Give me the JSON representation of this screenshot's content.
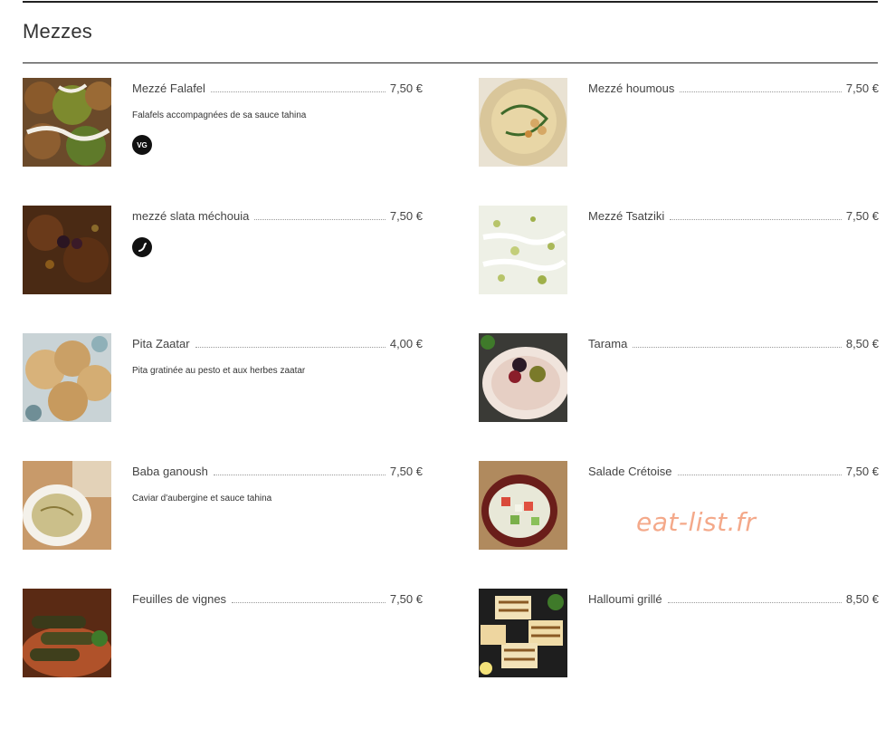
{
  "section": {
    "title": "Mezzes"
  },
  "items": [
    {
      "name": "Mezzé Falafel",
      "price": "7,50 €",
      "description": "Falafels accompagnées de sa sauce tahina",
      "badge": "VG"
    },
    {
      "name": "Mezzé houmous",
      "price": "7,50 €"
    },
    {
      "name": "mezzé slata méchouia",
      "price": "7,50 €",
      "badge_icon": "chili-pepper-icon"
    },
    {
      "name": "Mezzé Tsatziki",
      "price": "7,50 €"
    },
    {
      "name": "Pita Zaatar",
      "price": "4,00 €",
      "description": "Pita gratinée au pesto et aux herbes zaatar"
    },
    {
      "name": "Tarama",
      "price": "8,50 €"
    },
    {
      "name": "Baba ganoush",
      "price": "7,50 €",
      "description": "Caviar d'aubergine et sauce tahina"
    },
    {
      "name": "Salade Crétoise",
      "price": "7,50 €"
    },
    {
      "name": "Feuilles de vignes",
      "price": "7,50 €"
    },
    {
      "name": "Halloumi grillé",
      "price": "8,50 €"
    }
  ],
  "watermark": "eat-list.fr",
  "colors": {
    "rule": "#222222",
    "watermark": "#f4a98a",
    "badge": "#111111"
  }
}
